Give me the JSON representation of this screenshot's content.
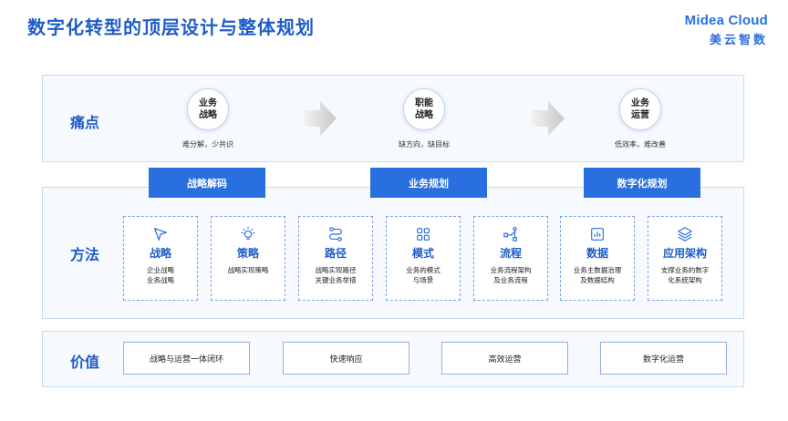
{
  "title": "数字化转型的顶层设计与整体规划",
  "logo": {
    "en": "Midea Cloud",
    "zh": "美云智数"
  },
  "pain": {
    "label": "痛点",
    "items": [
      {
        "circle": "业务战略",
        "desc": "难分解，少共识"
      },
      {
        "circle": "职能战略",
        "desc": "缺方向，缺目标"
      },
      {
        "circle": "业务运营",
        "desc": "低效率，难改善"
      }
    ]
  },
  "banners": [
    "战略解码",
    "业务规划",
    "数字化规划"
  ],
  "method": {
    "label": "方法",
    "cards": [
      {
        "icon": "send-icon",
        "title": "战略",
        "desc": "企业战略\n业务战略"
      },
      {
        "icon": "lightbulb-icon",
        "title": "策略",
        "desc": "战略实现策略"
      },
      {
        "icon": "route-icon",
        "title": "路径",
        "desc": "战略实现路径\n关键业务举措"
      },
      {
        "icon": "grid-icon",
        "title": "模式",
        "desc": "业务的模式\n与场景"
      },
      {
        "icon": "flow-icon",
        "title": "流程",
        "desc": "业务流程架构\n及业务流程"
      },
      {
        "icon": "chart-icon",
        "title": "数据",
        "desc": "业务主数据治理\n及数据结构"
      },
      {
        "icon": "layers-icon",
        "title": "应用架构",
        "desc": "支撑业务的数字\n化系统架构"
      }
    ]
  },
  "value": {
    "label": "价值",
    "items": [
      "战略与运营一体闭环",
      "快速响应",
      "高效运营",
      "数字化运营"
    ]
  },
  "colors": {
    "primary": "#2a6fe0",
    "title": "#1f5cc9",
    "panel": "#f6f9fe"
  }
}
